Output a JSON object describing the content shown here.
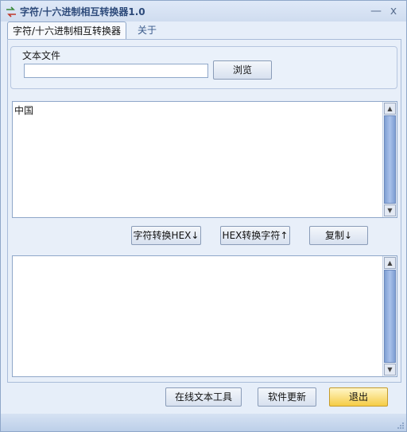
{
  "window": {
    "title": "字符/十六进制相互转换器1.0",
    "minimize_label": "—",
    "close_label": "x"
  },
  "tabs": [
    {
      "label": "字符/十六进制相互转换器",
      "active": true
    },
    {
      "label": "关于",
      "active": false
    }
  ],
  "file_group": {
    "label": "文本文件",
    "input_value": "",
    "browse_label": "浏览"
  },
  "input_text": {
    "value": "中国"
  },
  "actions": {
    "to_hex_label": "字符转换HEX↓",
    "to_char_label": "HEX转换字符↑",
    "copy_label": "复制↓"
  },
  "output_text": {
    "value": ""
  },
  "footer": {
    "online_tools_label": "在线文本工具",
    "update_label": "软件更新",
    "exit_label": "退出"
  },
  "colors": {
    "accent": "#2d4a7a",
    "exit_button": "#f5cc45",
    "scrollbar_thumb": "#7f9fd3"
  },
  "icons": {
    "app": "arrows-swap-icon",
    "scroll_up": "triangle-up-icon",
    "scroll_down": "triangle-down-icon"
  }
}
